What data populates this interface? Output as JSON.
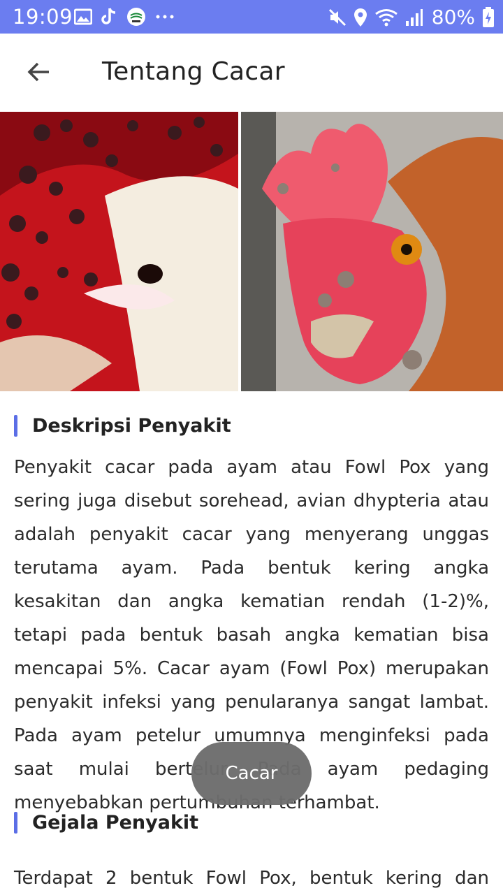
{
  "status_bar": {
    "time": "19:09",
    "battery": "80%",
    "icons_left": [
      "gallery-icon",
      "tiktok-icon",
      "app-logo-icon",
      "more-dots-icon"
    ],
    "icons_right": [
      "mute-icon",
      "location-icon",
      "wifi-icon",
      "signal-icon",
      "battery-charging-icon"
    ],
    "color": "#6b7df0"
  },
  "appbar": {
    "title": "Tentang Cacar",
    "back_icon": "arrow-left-icon"
  },
  "hero_images": [
    {
      "name": "chicken-pox-left-image"
    },
    {
      "name": "chicken-pox-right-image"
    }
  ],
  "sections": [
    {
      "title": "Deskripsi Penyakit",
      "body": "Penyakit cacar pada ayam atau Fowl Pox yang sering juga disebut sorehead, avian dhypteria atau adalah penyakit cacar yang menyerang unggas terutama ayam. Pada bentuk kering angka kesakitan dan angka kematian rendah (1-2)%, tetapi pada bentuk basah angka kematian bisa mencapai 5%. Cacar ayam (Fowl Pox) merupakan penyakit infeksi yang penularanya sangat lambat. Pada ayam petelur umumnya menginfeksi pada saat mulai bertelur. Pada ayam pedaging menyebabkan pertumbuhan terhambat."
    },
    {
      "title": "Gejala Penyakit",
      "body": "Terdapat 2 bentuk Fowl Pox, bentuk kering dan"
    }
  ],
  "toast": {
    "text": "Cacar"
  },
  "accent_color": "#5b6ee6"
}
